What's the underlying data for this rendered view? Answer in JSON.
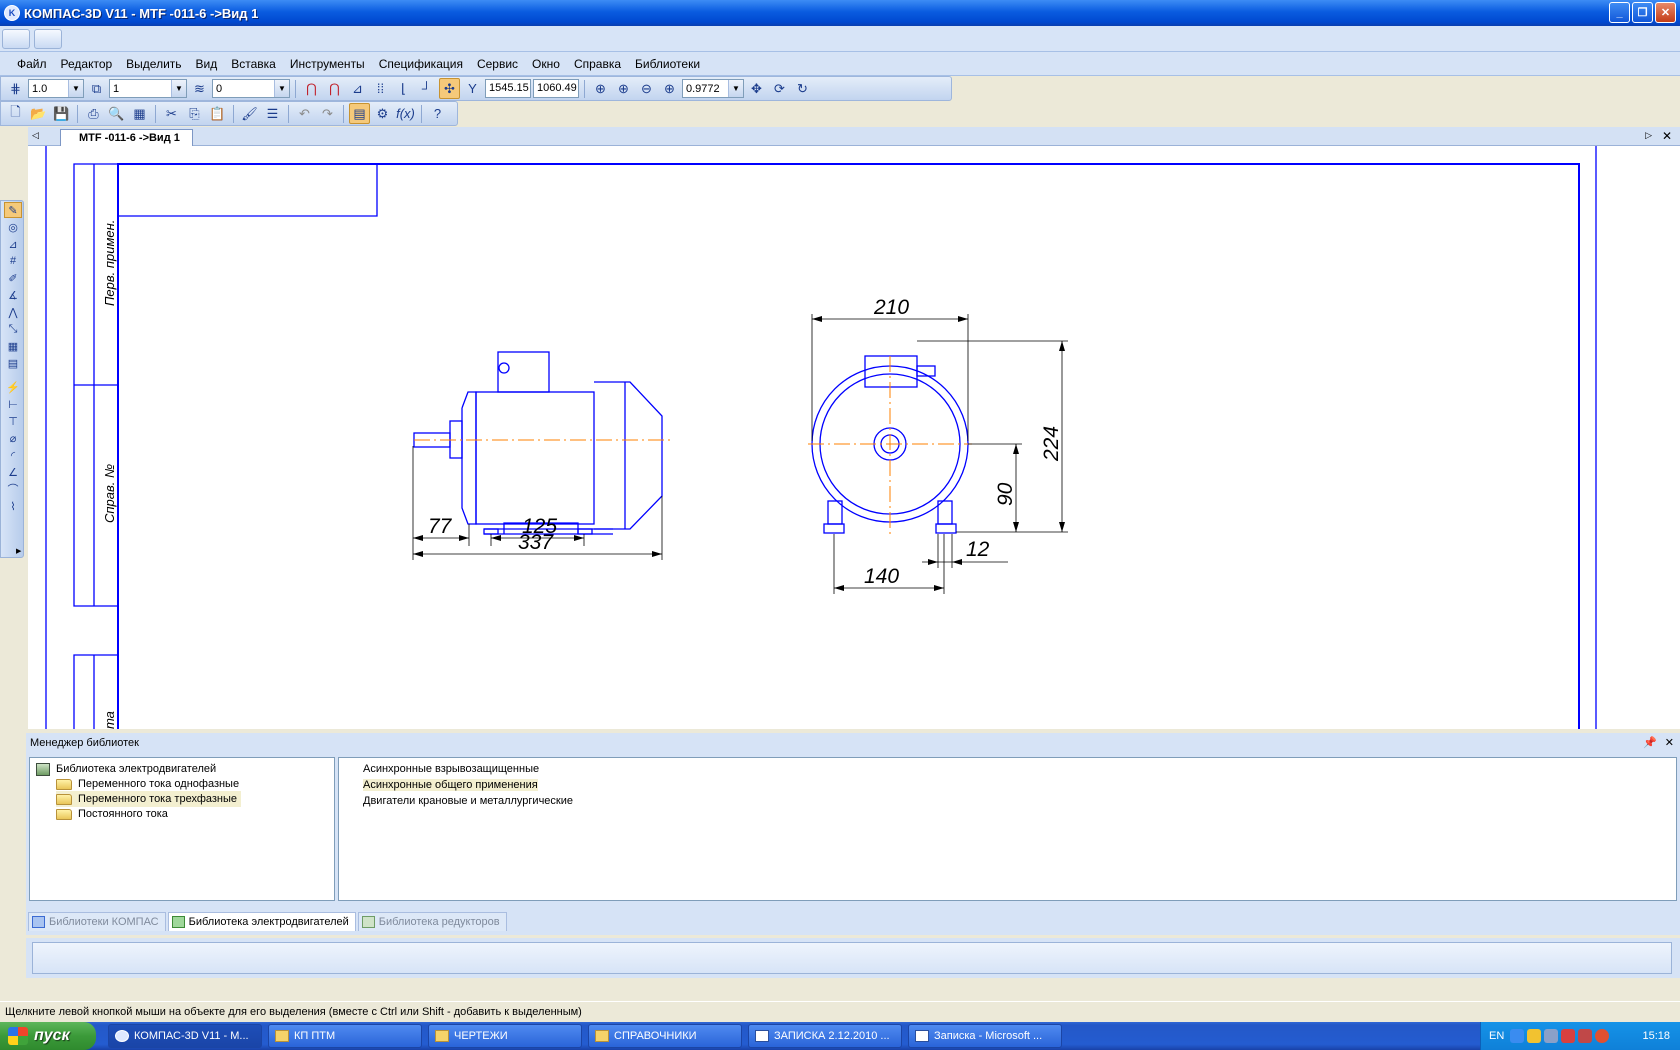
{
  "window": {
    "title": "КОМПАС-3D V11 - MTF -011-6 ->Вид 1",
    "app_icon_text": "K",
    "controls": [
      "_",
      "❐",
      "✕"
    ]
  },
  "menu": [
    "Файл",
    "Редактор",
    "Выделить",
    "Вид",
    "Вставка",
    "Инструменты",
    "Спецификация",
    "Сервис",
    "Окно",
    "Справка",
    "Библиотеки"
  ],
  "toolbar": {
    "step_value": "1.0",
    "layer_value": "1",
    "style_value": "0",
    "coord_x": "1545.15",
    "coord_y": "1060.49",
    "zoom_value": "0.9772"
  },
  "document": {
    "tab_label": "MTF -011-6 ->Вид 1",
    "frame_labels": {
      "perv": "Перв. примен.",
      "sprav": "Справ. №",
      "partial": "та"
    },
    "dimensions": {
      "d77": "77",
      "d125": "125",
      "d337": "337",
      "d210": "210",
      "d224": "224",
      "d90": "90",
      "d140": "140",
      "d12": "12"
    }
  },
  "library": {
    "title": "Менеджер библиотек",
    "tree": {
      "root": "Библиотека электродвигателей",
      "children": [
        "Переменного тока однофазные",
        "Переменного тока трехфазные",
        "Постоянного тока"
      ]
    },
    "list": [
      "Асинхронные взрывозащищенные",
      "Асинхронные общего применения",
      "Двигатели крановые и металлургические"
    ],
    "tabs": [
      "Библиотеки КОМПАС",
      "Библиотека электродвигателей",
      "Библиотека редукторов"
    ]
  },
  "status_text": "Щелкните левой кнопкой мыши на объекте для его выделения (вместе с Ctrl или Shift - добавить к выделенным)",
  "taskbar": {
    "start_label": "пуск",
    "items": [
      "КОМПАС-3D V11 - М...",
      "КП ПТМ",
      "ЧЕРТЕЖИ",
      "СПРАВОЧНИКИ",
      "ЗАПИСКА 2.12.2010 ...",
      "Записка - Microsoft ..."
    ],
    "lang": "EN",
    "clock": "15:18"
  },
  "colors": {
    "drawing_blue": "#0000ff",
    "axis_orange": "#ff8000",
    "selection": "#f5c97a"
  }
}
